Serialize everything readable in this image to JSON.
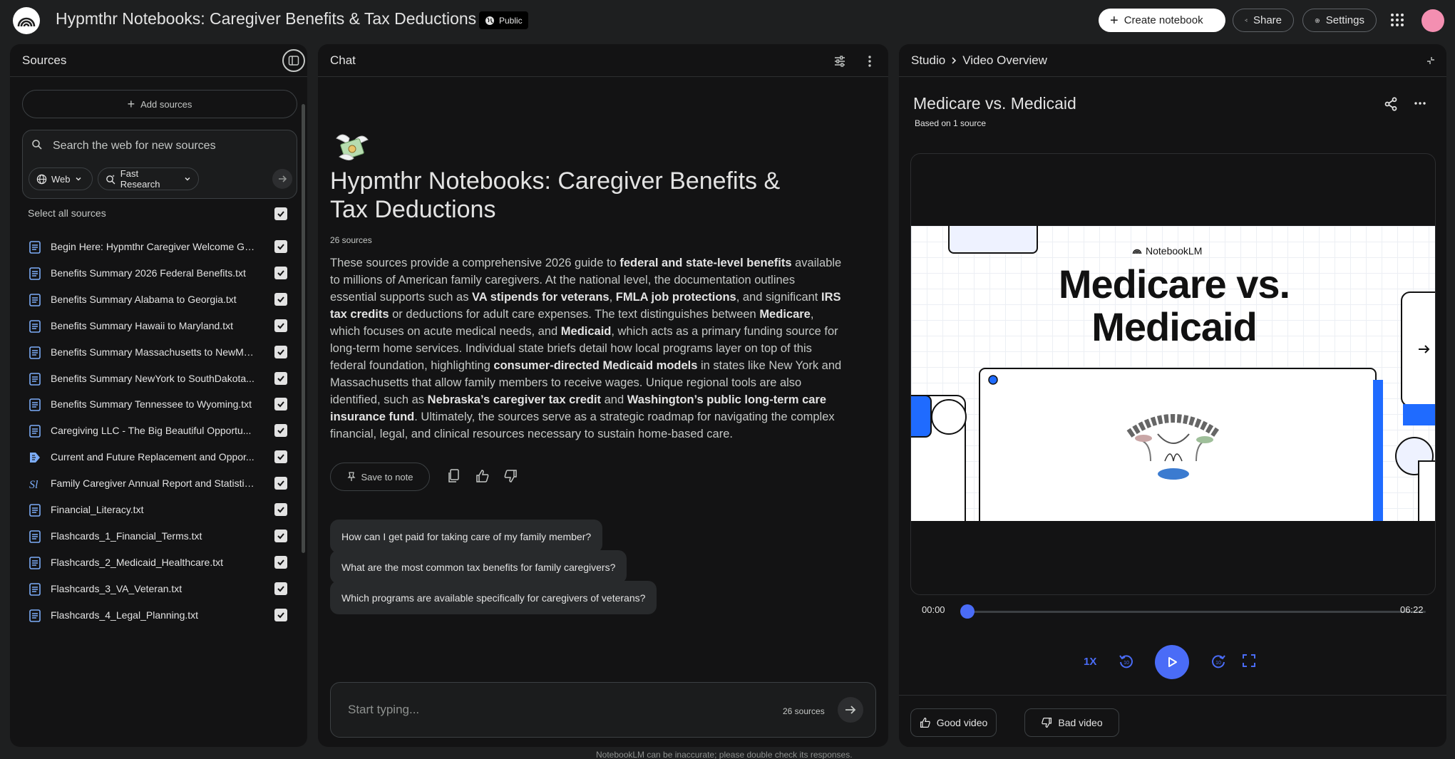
{
  "app": {
    "notebook_title": "Hypmthr Notebooks: Caregiver Benefits & Tax Deductions",
    "visibility": "Public",
    "create_notebook": "Create notebook",
    "share": "Share",
    "settings": "Settings"
  },
  "sources": {
    "title": "Sources",
    "add_sources": "Add sources",
    "search_placeholder": "Search the web for new sources",
    "web_chip": "Web",
    "research_chip": "Fast Research",
    "select_all": "Select all sources",
    "items": [
      {
        "label": "Begin Here: Hypmthr Caregiver Welcome Gu...",
        "icon": "doc-icon"
      },
      {
        "label": "Benefits Summary 2026 Federal Benefits.txt",
        "icon": "doc-icon"
      },
      {
        "label": "Benefits Summary Alabama to Georgia.txt",
        "icon": "doc-icon"
      },
      {
        "label": "Benefits Summary Hawaii to Maryland.txt",
        "icon": "doc-icon"
      },
      {
        "label": "Benefits Summary Massachusetts to NewMe...",
        "icon": "doc-icon"
      },
      {
        "label": "Benefits Summary NewYork to SouthDakota...",
        "icon": "doc-icon"
      },
      {
        "label": "Benefits Summary Tennessee to Wyoming.txt",
        "icon": "doc-icon"
      },
      {
        "label": "Caregiving LLC - The Big Beautiful Opportu...",
        "icon": "doc-icon"
      },
      {
        "label": "Current and Future Replacement and Oppor...",
        "icon": "slides-icon"
      },
      {
        "label": "Family Caregiver Annual Report and Statistic...",
        "icon": "sl-icon"
      },
      {
        "label": "Financial_Literacy.txt",
        "icon": "doc-icon"
      },
      {
        "label": "Flashcards_1_Financial_Terms.txt",
        "icon": "doc-icon"
      },
      {
        "label": "Flashcards_2_Medicaid_Healthcare.txt",
        "icon": "doc-icon"
      },
      {
        "label": "Flashcards_3_VA_Veteran.txt",
        "icon": "doc-icon"
      },
      {
        "label": "Flashcards_4_Legal_Planning.txt",
        "icon": "doc-icon"
      }
    ]
  },
  "chat": {
    "title": "Chat",
    "heading": "Hypmthr Notebooks: Caregiver Benefits & Tax Deductions",
    "source_count": "26 sources",
    "summary": [
      {
        "t": "These sources provide a comprehensive 2026 guide to ",
        "b": false
      },
      {
        "t": "federal and state-level benefits",
        "b": true
      },
      {
        "t": " available to millions of American family caregivers. At the national level, the documentation outlines essential supports such as ",
        "b": false
      },
      {
        "t": "VA stipends for veterans",
        "b": true
      },
      {
        "t": ", ",
        "b": false
      },
      {
        "t": "FMLA job protections",
        "b": true
      },
      {
        "t": ", and significant ",
        "b": false
      },
      {
        "t": "IRS tax credits",
        "b": true
      },
      {
        "t": " or deductions for adult care expenses. The text distinguishes between ",
        "b": false
      },
      {
        "t": "Medicare",
        "b": true
      },
      {
        "t": ", which focuses on acute medical needs, and ",
        "b": false
      },
      {
        "t": "Medicaid",
        "b": true
      },
      {
        "t": ", which acts as a primary funding source for long-term home services. Individual state briefs detail how local programs layer on top of this federal foundation, highlighting ",
        "b": false
      },
      {
        "t": "consumer-directed Medicaid models",
        "b": true
      },
      {
        "t": " in states like New York and Massachusetts that allow family members to receive wages. Unique regional tools are also identified, such as ",
        "b": false
      },
      {
        "t": "Nebraska’s caregiver tax credit",
        "b": true
      },
      {
        "t": " and ",
        "b": false
      },
      {
        "t": "Washington’s public long-term care insurance fund",
        "b": true
      },
      {
        "t": ". Ultimately, the sources serve as a strategic roadmap for navigating the complex financial, legal, and clinical resources necessary to sustain home-based care.",
        "b": false
      }
    ],
    "save_to_note": "Save to note",
    "suggestions": [
      "How can I get paid for taking care of my family member?",
      "What are the most common tax benefits for family caregivers?",
      "Which programs are available specifically for caregivers of veterans?"
    ],
    "input_placeholder": "Start typing...",
    "input_source_count": "26 sources",
    "disclaimer": "NotebookLM can be inaccurate; please double check its responses."
  },
  "studio": {
    "crumb_root": "Studio",
    "crumb_current": "Video Overview",
    "video_title": "Medicare vs. Medicaid",
    "based_on": "Based on 1 source",
    "slide_brand": "NotebookLM",
    "slide_title": "Medicare vs. Medicaid",
    "time_current": "00:00",
    "time_total": "06:22",
    "playback_progress": 0,
    "speed": "1X",
    "good_video": "Good video",
    "bad_video": "Bad video"
  },
  "colors": {
    "accent": "#4a6cf7",
    "background": "#1e1f20",
    "panel": "#131314"
  }
}
